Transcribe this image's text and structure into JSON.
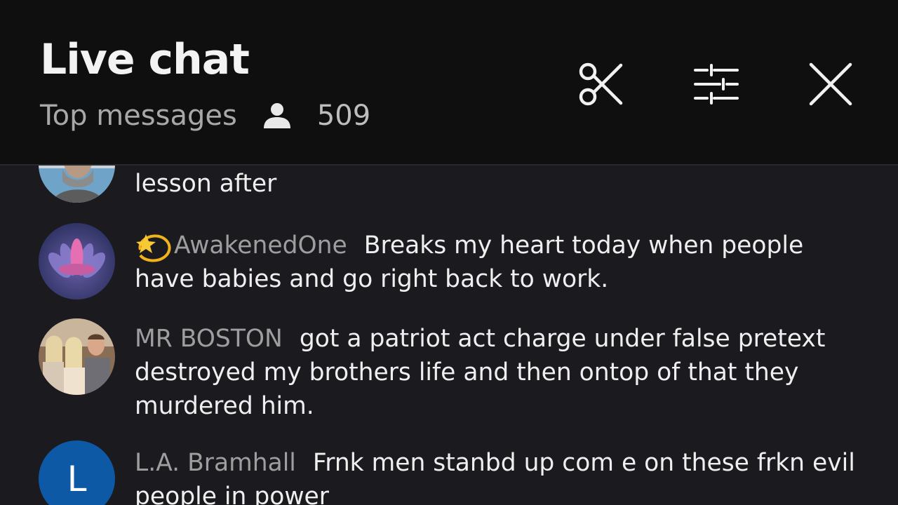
{
  "header": {
    "title": "Live chat",
    "mode": "Top messages",
    "viewer_count": "509"
  },
  "icons": {
    "clip": "scissors-icon",
    "settings": "sliders-icon",
    "close": "close-icon",
    "viewers": "person-icon"
  },
  "messages": [
    {
      "author": "",
      "text": "lesson after"
    },
    {
      "author": "AwakenedOne",
      "badge": "💫",
      "text": "Breaks my heart today when people have babies and go right back to work."
    },
    {
      "author": "MR BOSTON",
      "text": "got a patriot act charge under false pretext destroyed my brothers life and then ontop of that they murdered him."
    },
    {
      "author": "L.A. Bramhall",
      "avatar_initial": "L",
      "text": "Frnk men stanbd up com e on these frkn evil people in power"
    }
  ],
  "colors": {
    "header_bg": "#0f0f0f",
    "chat_bg": "#1b1a1f",
    "author": "#9e9e9e",
    "avatar_blue": "#0d59a5"
  }
}
